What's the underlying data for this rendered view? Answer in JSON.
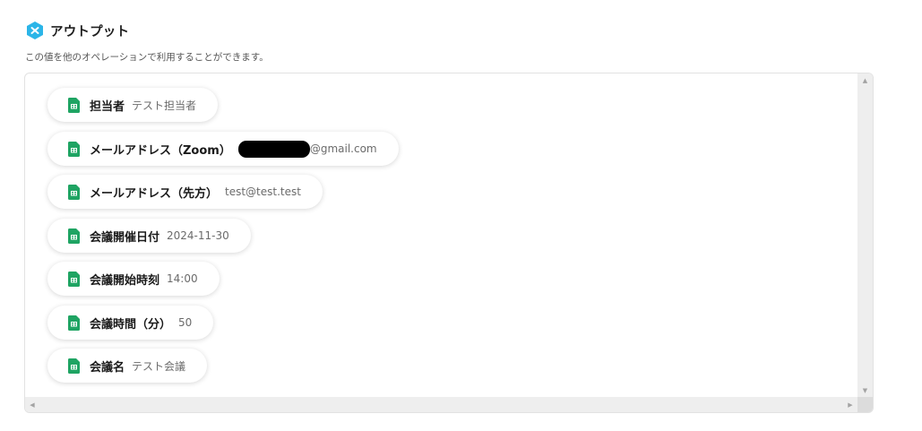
{
  "header": {
    "title": "アウトプット",
    "description": "この値を他のオペレーションで利用することができます。",
    "logo_icon": "yoom-logo-icon",
    "accent_color": "#2bb5e8"
  },
  "outputs": [
    {
      "label": "担当者",
      "value": "テスト担当者",
      "icon": "google-sheets-icon"
    },
    {
      "label": "メールアドレス（Zoom）",
      "value": "@gmail.com",
      "redacted_prefix": true,
      "icon": "google-sheets-icon"
    },
    {
      "label": "メールアドレス（先方）",
      "value": "test@test.test",
      "icon": "google-sheets-icon"
    },
    {
      "label": "会議開催日付",
      "value": "2024-11-30",
      "icon": "google-sheets-icon"
    },
    {
      "label": "会議開始時刻",
      "value": "14:00",
      "icon": "google-sheets-icon"
    },
    {
      "label": "会議時間（分）",
      "value": "50",
      "icon": "google-sheets-icon"
    },
    {
      "label": "会議名",
      "value": "テスト会議",
      "icon": "google-sheets-icon"
    }
  ],
  "colors": {
    "sheets_green": "#1fa463",
    "chip_bg": "#ffffff",
    "scrollbar": "#eeeeee"
  }
}
